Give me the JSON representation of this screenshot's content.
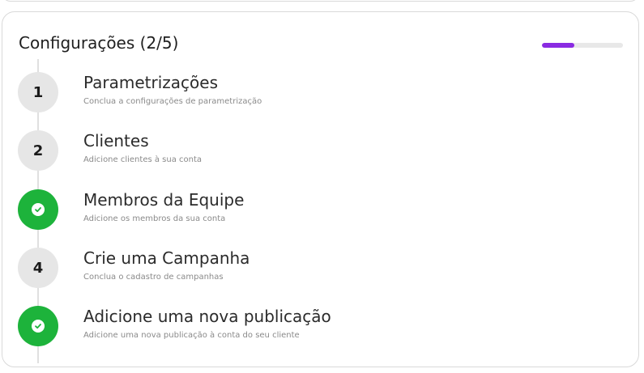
{
  "card": {
    "title": "Configurações (2/5)",
    "progress": {
      "completed": 2,
      "total": 5,
      "color": "#8a2be2"
    }
  },
  "steps": [
    {
      "badge": "1",
      "status": "pending",
      "title": "Parametrizações",
      "description": "Conclua a configurações de parametrização"
    },
    {
      "badge": "2",
      "status": "pending",
      "title": "Clientes",
      "description": "Adicione clientes à sua conta"
    },
    {
      "badge": "",
      "status": "done",
      "icon": "check-icon",
      "title": "Membros da Equipe",
      "description": "Adicione os membros da sua conta"
    },
    {
      "badge": "4",
      "status": "pending",
      "title": "Crie uma Campanha",
      "description": "Conclua o cadastro de campanhas"
    },
    {
      "badge": "",
      "status": "done",
      "icon": "check-icon",
      "title": "Adicione uma nova publicação",
      "description": "Adicione uma nova publicação à conta do seu cliente"
    }
  ],
  "colors": {
    "done": "#1db33b",
    "pending": "#e6e6e6"
  }
}
